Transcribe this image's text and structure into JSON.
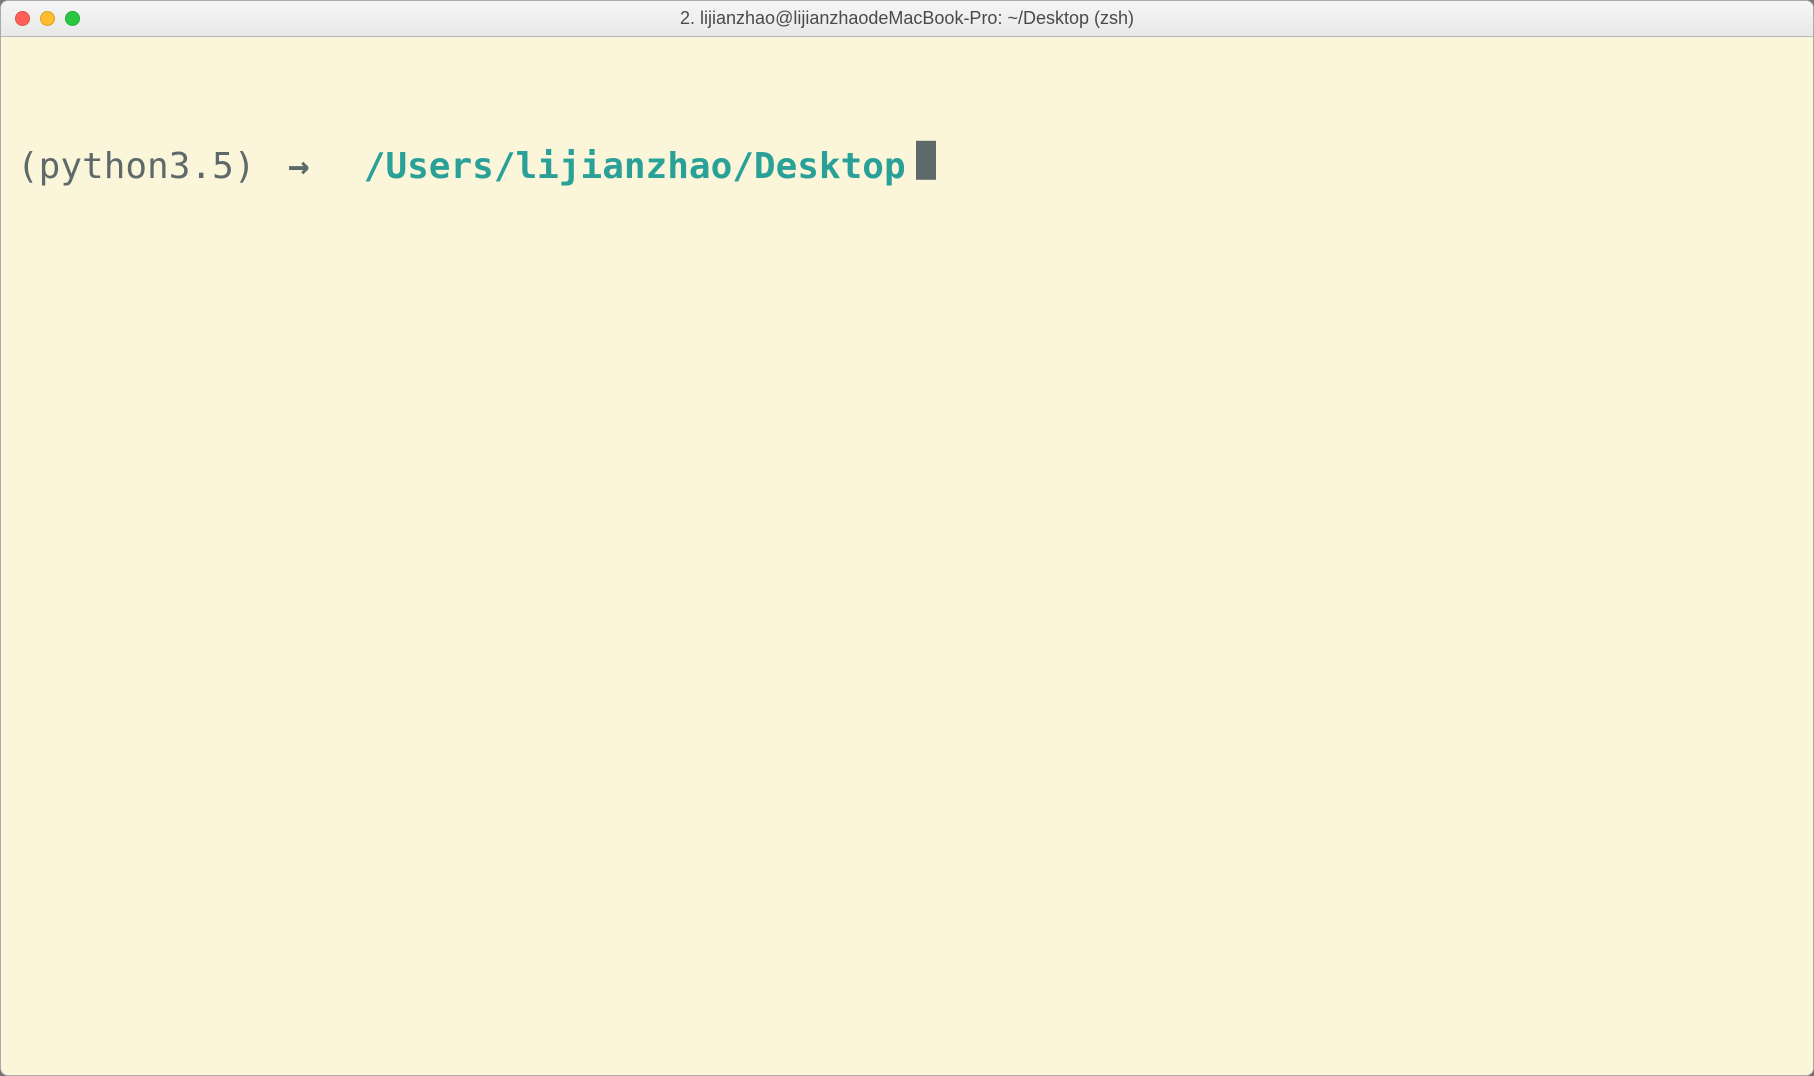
{
  "window": {
    "title": "2. lijianzhao@lijianzhaodeMacBook-Pro: ~/Desktop (zsh)"
  },
  "prompt": {
    "venv": "(python3.5)",
    "arrow": "→",
    "cwd": "/Users/lijianzhao/Desktop"
  },
  "colors": {
    "background": "#fbf5d9",
    "text_default": "#5e6a6a",
    "cwd": "#2aa198",
    "cursor": "#5e6a6a"
  }
}
